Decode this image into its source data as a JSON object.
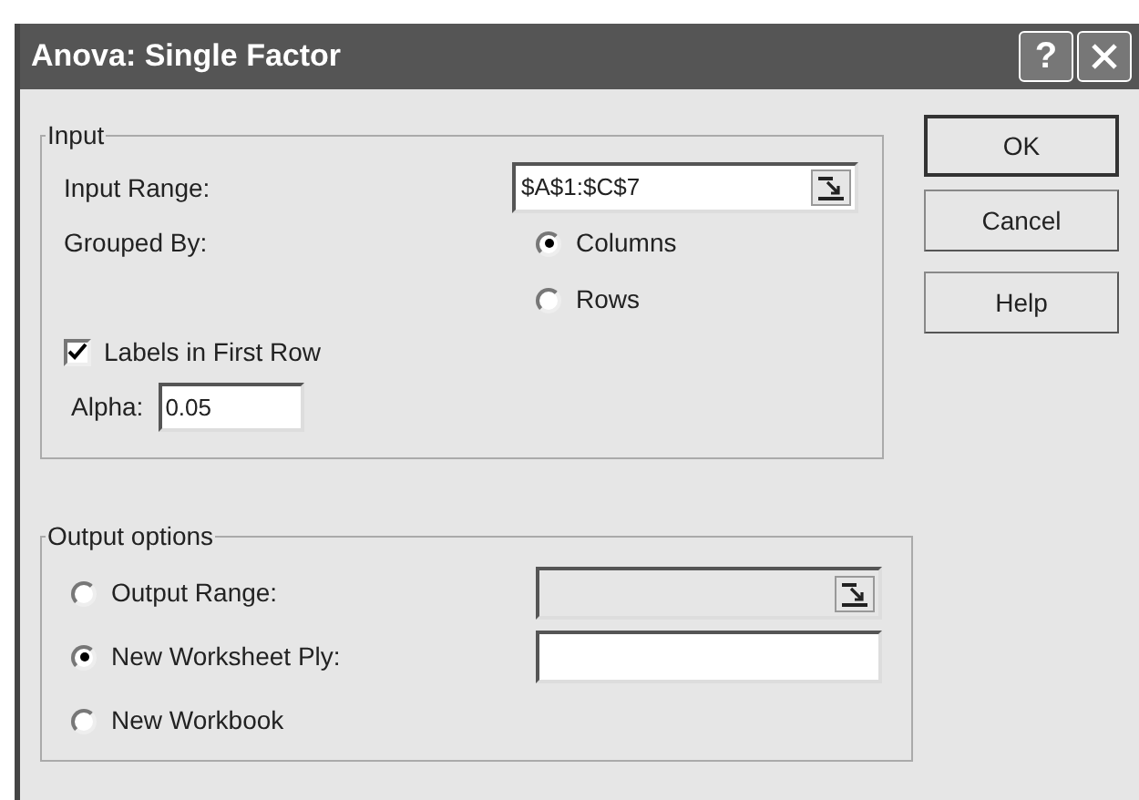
{
  "window": {
    "title": "Anova: Single Factor",
    "title_buttons": [
      "?"
    ]
  },
  "input_group": {
    "legend": "Input",
    "input_range": {
      "label": "Input Range:",
      "value": "$A$1:$C$7"
    },
    "grouped_by": {
      "label": "Grouped By:",
      "options": [
        {
          "label": "Columns",
          "selected": true
        },
        {
          "label": "Rows",
          "selected": false
        }
      ]
    },
    "labels_in_first_row": {
      "label": "Labels in First Row",
      "checked": true
    },
    "alpha": {
      "label": "Alpha:",
      "value": "0.05"
    }
  },
  "output_group": {
    "legend": "Output options",
    "options": [
      {
        "label": "Output Range:",
        "selected": false,
        "field": {
          "disabled": true
        }
      },
      {
        "label": "New Worksheet Ply:",
        "selected": true,
        "field": {
          "disabled": false
        }
      },
      {
        "label": "New Workbook",
        "selected": false
      }
    ]
  },
  "buttons": [
    {
      "label": "OK",
      "default": true
    },
    {
      "label": "Cancel",
      "default": false
    },
    {
      "label": "Help",
      "default": false
    }
  ]
}
